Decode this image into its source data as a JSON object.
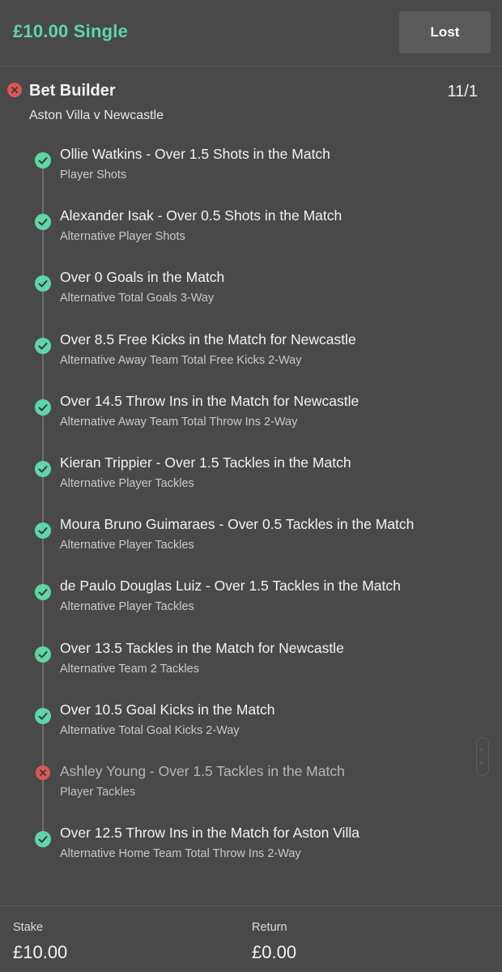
{
  "header": {
    "bet_title": "£10.00 Single",
    "status_label": "Lost"
  },
  "builder": {
    "title": "Bet Builder",
    "odds": "11/1",
    "match": "Aston Villa v Newcastle",
    "result": "lost"
  },
  "legs": [
    {
      "title": "Ollie Watkins - Over 1.5 Shots in the Match",
      "market": "Player Shots",
      "result": "won"
    },
    {
      "title": "Alexander Isak - Over 0.5 Shots in the Match",
      "market": "Alternative Player Shots",
      "result": "won"
    },
    {
      "title": "Over 0 Goals in the Match",
      "market": "Alternative Total Goals 3-Way",
      "result": "won"
    },
    {
      "title": "Over 8.5 Free Kicks in the Match for Newcastle",
      "market": "Alternative Away Team Total Free Kicks 2-Way",
      "result": "won"
    },
    {
      "title": "Over 14.5 Throw Ins in the Match for Newcastle",
      "market": "Alternative Away Team Total Throw Ins 2-Way",
      "result": "won"
    },
    {
      "title": "Kieran Trippier - Over 1.5 Tackles in the Match",
      "market": "Alternative Player Tackles",
      "result": "won"
    },
    {
      "title": "Moura Bruno Guimaraes - Over 0.5 Tackles in the Match",
      "market": "Alternative Player Tackles",
      "result": "won"
    },
    {
      "title": "de Paulo Douglas Luiz - Over 1.5 Tackles in the Match",
      "market": "Alternative Player Tackles",
      "result": "won"
    },
    {
      "title": "Over 13.5 Tackles in the Match for Newcastle",
      "market": "Alternative Team 2 Tackles",
      "result": "won"
    },
    {
      "title": "Over 10.5 Goal Kicks in the Match",
      "market": "Alternative Total Goal Kicks 2-Way",
      "result": "won"
    },
    {
      "title": "Ashley Young - Over 1.5 Tackles in the Match",
      "market": "Player Tackles",
      "result": "lost"
    },
    {
      "title": "Over 12.5 Throw Ins in the Match for Aston Villa",
      "market": "Alternative Home Team Total Throw Ins 2-Way",
      "result": "won"
    }
  ],
  "footer": {
    "stake_label": "Stake",
    "stake_value": "£10.00",
    "return_label": "Return",
    "return_value": "£0.00"
  },
  "colors": {
    "background": "#494949",
    "won": "#5ed6a6",
    "lost": "#d95757",
    "accent": "#5ed6a6"
  }
}
